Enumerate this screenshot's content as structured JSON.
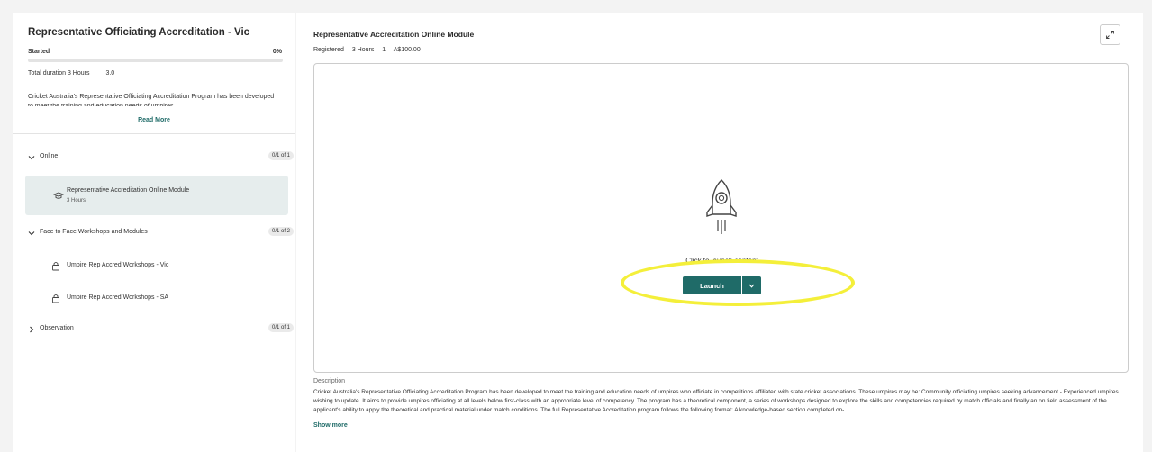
{
  "course": {
    "title": "Representative Officiating Accreditation - Vic",
    "status": "Started",
    "progress_pct": "0%",
    "progress_fraction": 0,
    "duration_label": "Total duration 3 Hours",
    "duration_value": "3.0",
    "description": "Cricket Australia's Representative Officiating Accreditation Program has been developed to meet the training and education needs of umpires",
    "read_more": "Read More"
  },
  "sections": [
    {
      "label": "Online",
      "count": "0/1 of 1",
      "items": [
        {
          "title": "Representative Accreditation Online Module",
          "subtitle": "3 Hours",
          "icon": "graduation-cap-icon"
        }
      ]
    },
    {
      "label": "Face to Face Workshops and Modules",
      "count": "0/1 of 2",
      "items": [
        {
          "title": "Umpire Rep Accred Workshops - Vic",
          "icon": "lock-icon"
        },
        {
          "title": "Umpire Rep Accred Workshops - SA",
          "icon": "lock-icon"
        }
      ]
    },
    {
      "label": "Observation",
      "count": "0/1 of 1",
      "items": []
    }
  ],
  "module": {
    "title": "Representative Accreditation Online Module",
    "meta": [
      "Registered",
      "3 Hours",
      "1",
      "A$100.00"
    ],
    "launch_prompt": "Click to launch content",
    "launch_label": "Launch",
    "description_label": "Description",
    "description": "Cricket Australia's Representative Officiating Accreditation Program has been developed to meet the training and education needs of umpires who officiate in competitions affiliated with state cricket associations. These umpires may be: Community officiating umpires seeking advancement - Experienced umpires wishing to update. It aims to provide umpires officiating at all levels below first-class with an appropriate level of competency. The program has a theoretical component, a series of workshops designed to explore the skills and competencies required by match officials and finally an on field assessment of the applicant's ability to apply the theoretical and practical material under match conditions. The full Representative Accreditation program follows the following format: A knowledge-based section completed on-...",
    "show_more": "Show more"
  },
  "colors": {
    "accent": "#1f6b68",
    "highlight": "#f4ef3a",
    "active_bg": "#e6eded"
  }
}
